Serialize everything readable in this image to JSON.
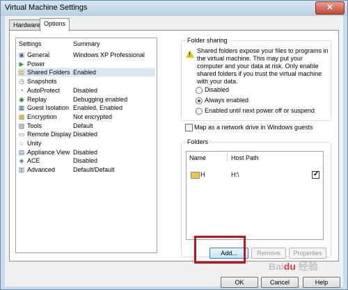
{
  "window": {
    "title": "Virtual Machine Settings",
    "close_glyph": "✕"
  },
  "tabs": [
    {
      "label": "Hardware",
      "active": false
    },
    {
      "label": "Options",
      "active": true
    }
  ],
  "settings_list": {
    "col_settings": "Settings",
    "col_summary": "Summary",
    "items": [
      {
        "name": "General",
        "summary": "Windows XP Professional",
        "icon": "general-icon"
      },
      {
        "name": "Power",
        "summary": "",
        "icon": "power-icon"
      },
      {
        "name": "Shared Folders",
        "summary": "Enabled",
        "icon": "shared-folders-icon",
        "selected": true
      },
      {
        "name": "Snapshots",
        "summary": "",
        "icon": "snapshots-icon"
      },
      {
        "name": "AutoProtect",
        "summary": "Disabled",
        "icon": "autoprotect-icon"
      },
      {
        "name": "Replay",
        "summary": "Debugging enabled",
        "icon": "replay-icon"
      },
      {
        "name": "Guest Isolation",
        "summary": "Enabled, Enabled",
        "icon": "guest-isolation-icon"
      },
      {
        "name": "Encryption",
        "summary": "Not encrypted",
        "icon": "encryption-icon"
      },
      {
        "name": "Tools",
        "summary": "Default",
        "icon": "tools-icon"
      },
      {
        "name": "Remote Display",
        "summary": "Disabled",
        "icon": "remote-display-icon"
      },
      {
        "name": "Unity",
        "summary": "",
        "icon": "unity-icon"
      },
      {
        "name": "Appliance View",
        "summary": "Disabled",
        "icon": "appliance-view-icon"
      },
      {
        "name": "ACE",
        "summary": "Disabled",
        "icon": "ace-icon"
      },
      {
        "name": "Advanced",
        "summary": "Default/Default",
        "icon": "advanced-icon"
      }
    ]
  },
  "folder_sharing": {
    "title": "Folder sharing",
    "warning": "Shared folders expose your files to programs in the virtual machine. This may put your computer and your data at risk. Only enable shared folders if you trust the virtual machine with your data.",
    "options": [
      {
        "label": "Disabled",
        "checked": false
      },
      {
        "label": "Always enabled",
        "checked": true
      },
      {
        "label": "Enabled until next power off or suspend",
        "checked": false
      }
    ],
    "map_drive_label": "Map as a network drive in Windows guests",
    "map_drive_checked": false
  },
  "folders": {
    "title": "Folders",
    "col_name": "Name",
    "col_host_path": "Host Path",
    "rows": [
      {
        "name": "H",
        "host_path": "H:\\",
        "enabled": true
      }
    ],
    "add_label": "Add...",
    "remove_label": "Remove",
    "properties_label": "Properties"
  },
  "footer": {
    "ok_label": "OK",
    "cancel_label": "Cancel",
    "help_label": "Help"
  },
  "watermark": "Baidu 经验"
}
